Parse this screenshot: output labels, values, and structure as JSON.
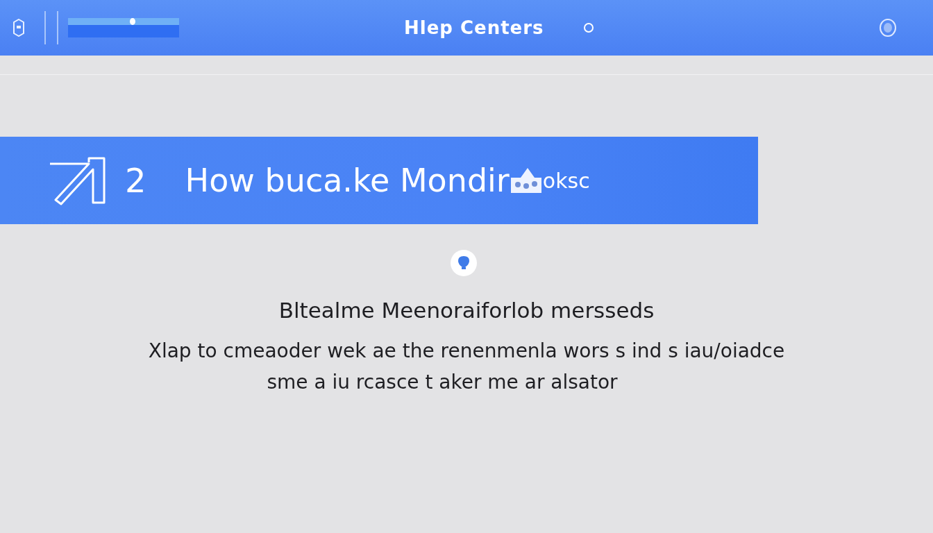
{
  "header": {
    "title": "Hlep Centers",
    "slider": {
      "level": 0.58
    }
  },
  "banner": {
    "number": "2",
    "title": "How buca.ke Mondir",
    "title_suffix": "oksc"
  },
  "subheading": "Bltealme Meenoraiforlob mersseds",
  "body_lines": [
    "Xlap to cmeaoder wek ae the renenmenla wors s ind s iau/oiadce",
    "sme a iu rcasce t aker me ar alsator"
  ]
}
